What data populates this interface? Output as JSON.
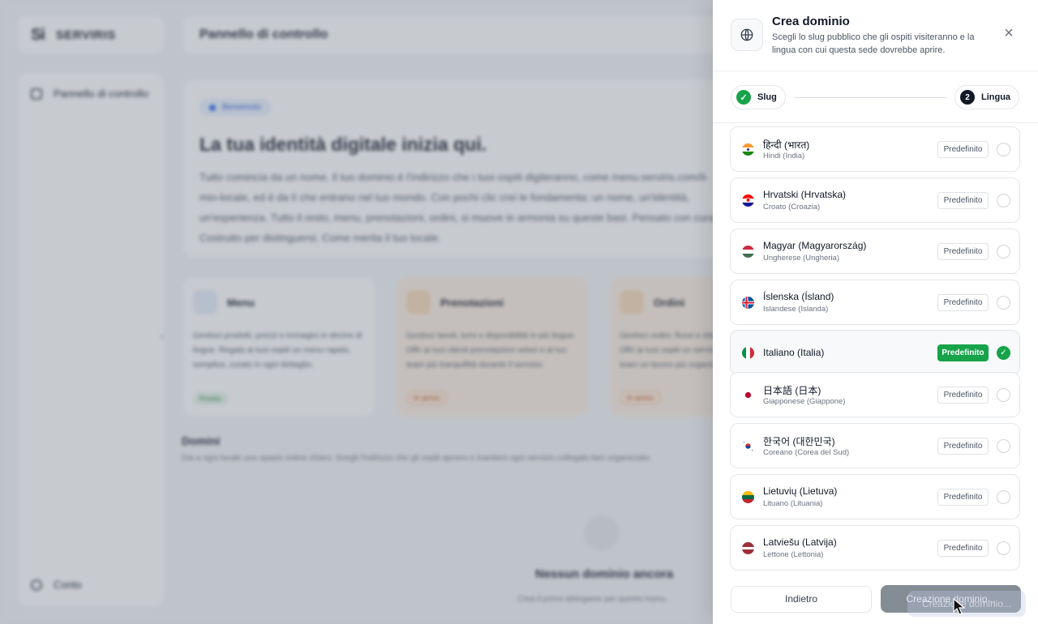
{
  "background": {
    "logo_mark": "Si",
    "brand": "SERVIRIS",
    "sidebar_items": [
      {
        "label": "Pannello di controllo",
        "icon": "dashboard-icon"
      },
      {
        "label": "Conto",
        "icon": "user-icon"
      }
    ],
    "page_title": "Pannello di controllo",
    "hero": {
      "badge": "Benvenuto",
      "title": "La tua identità digitale inizia qui.",
      "text": "Tutto comincia da un nome. Il tuo dominio è l'indirizzo che i tuoi ospiti digiteranno, come menu.serviris.com/il-mio-locale, ed è da lì che entrano nel tuo mondo. Con pochi clic crei le fondamenta: un nome, un'identità, un'esperienza. Tutto il resto, menu, prenotazioni, ordini, si muove in armonia su queste basi. Pensato con cura. Costruito per distinguersi. Come merita il tuo locale."
    },
    "cards": [
      {
        "title": "Menu",
        "text": "Gestisci prodotti, prezzi e immagini in decine di lingue. Regala ai tuoi ospiti un menu rapido, semplice, curato in ogni dettaglio.",
        "pill": "Pronto"
      },
      {
        "title": "Prenotazioni",
        "text": "Gestisci tavoli, turni e disponibilità in più lingue. Offri ai tuoi clienti prenotazioni veloci e al tuo team più tranquillità durante il servizio.",
        "pill": "In arrivo"
      },
      {
        "title": "Ordini",
        "text": "Gestisci ordini, flussi e stati in un solo posto. Offri ai tuoi ospiti un servizio più rapido e al tuo team un lavoro più organizzato.",
        "pill": "In arrivo"
      }
    ],
    "domains_title": "Domini",
    "domains_sub": "Dai a ogni locale uno spazio online chiaro. Scegli l'indirizzo che gli ospiti aprono e mantieni ogni servizio collegato ben organizzato.",
    "empty_title": "Nessun dominio ancora",
    "empty_sub": "Crea il primo attergame per questo menu."
  },
  "drawer": {
    "title": "Crea dominio",
    "subtitle": "Scegli lo slug pubblico che gli ospiti visiteranno e la lingua con cui questa sede dovrebbe aprire.",
    "close_icon": "close-icon",
    "steps": [
      {
        "label": "Slug",
        "state": "done"
      },
      {
        "number": "2",
        "label": "Lingua",
        "state": "active"
      }
    ],
    "default_label": "Predefinito",
    "languages": [
      {
        "name": "हिन्दी (भारत)",
        "sub": "Hindi (India)",
        "flag": "in",
        "selected": false
      },
      {
        "name": "Hrvatski (Hrvatska)",
        "sub": "Croato (Croazia)",
        "flag": "hr",
        "selected": false
      },
      {
        "name": "Magyar (Magyarország)",
        "sub": "Ungherese (Ungheria)",
        "flag": "hu",
        "selected": false
      },
      {
        "name": "Íslenska (Ísland)",
        "sub": "Islandese (Islanda)",
        "flag": "is",
        "selected": false
      },
      {
        "name": "Italiano (Italia)",
        "sub": "",
        "flag": "it",
        "selected": true
      },
      {
        "name": "日本語 (日本)",
        "sub": "Giapponese (Giappone)",
        "flag": "jp",
        "selected": false
      },
      {
        "name": "한국어 (대한민국)",
        "sub": "Coreano (Corea del Sud)",
        "flag": "kr",
        "selected": false
      },
      {
        "name": "Lietuvių (Lietuva)",
        "sub": "Lituano (Lituania)",
        "flag": "lt",
        "selected": false
      },
      {
        "name": "Latviešu (Latvija)",
        "sub": "Lettone (Lettonia)",
        "flag": "lv",
        "selected": false
      }
    ],
    "back_label": "Indietro",
    "create_label": "Creazione dominio..."
  },
  "colors": {
    "accent_green": "#16a34a",
    "scrim": "#6c7480"
  }
}
